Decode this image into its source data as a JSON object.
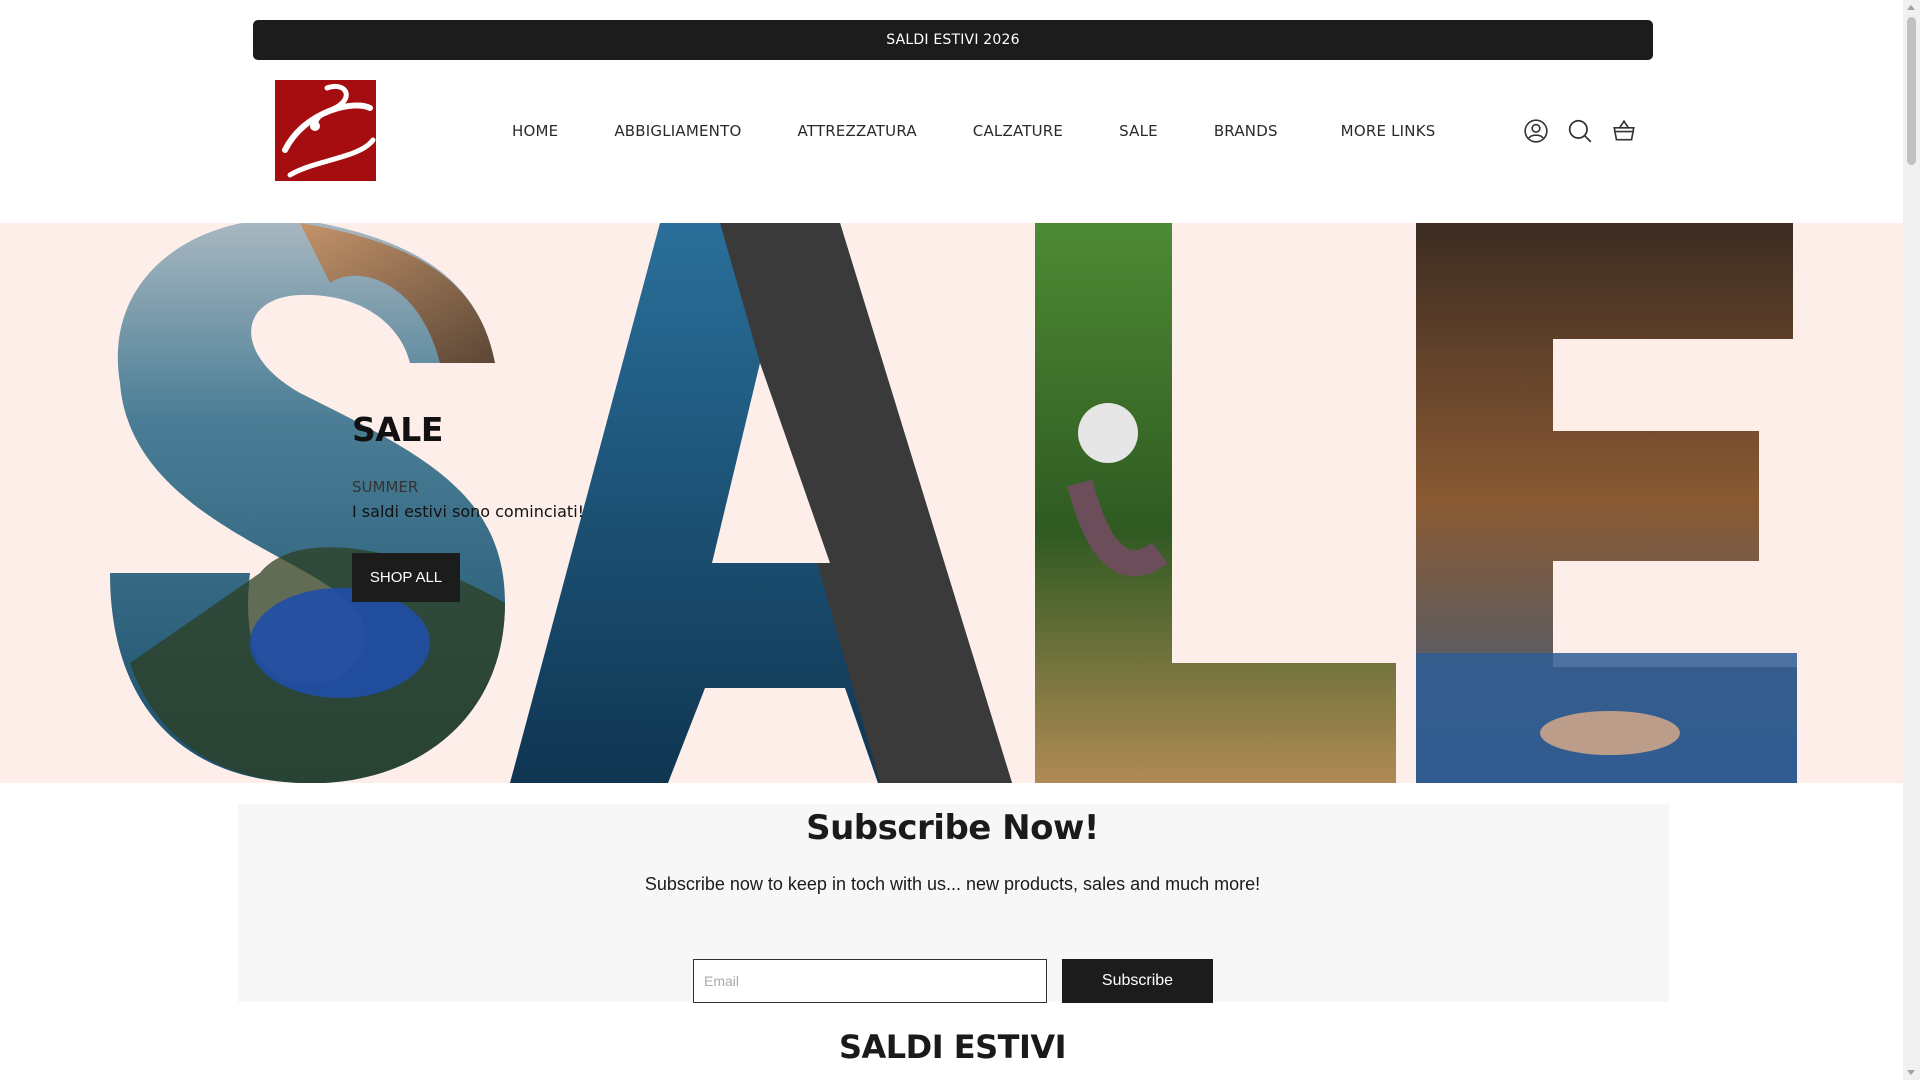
{
  "announcement": {
    "text": "SALDI ESTIVI 2026"
  },
  "header": {
    "logo_icon": "brand-logo",
    "nav": [
      {
        "label": "HOME"
      },
      {
        "label": "ABBIGLIAMENTO"
      },
      {
        "label": "ATTREZZATURA"
      },
      {
        "label": "CALZATURE"
      },
      {
        "label": "SALE"
      },
      {
        "label": "BRANDS"
      },
      {
        "label": "MORE LINKS"
      }
    ],
    "icons": [
      "account-icon",
      "search-icon",
      "cart-icon"
    ]
  },
  "hero": {
    "big_letters": "SALE",
    "title": "SALE",
    "subtitle": "SUMMER",
    "description": "I saldi estivi sono cominciati!",
    "button_label": "SHOP ALL"
  },
  "subscribe": {
    "title": "Subscribe Now!",
    "text": "Subscribe now to keep in toch with us... new products, sales and much more!",
    "email_placeholder": "Email",
    "button_label": "Subscribe"
  },
  "section": {
    "title": "SALDI ESTIVI"
  },
  "colors": {
    "brand_red": "#a60d10",
    "dark": "#1c1c1c",
    "hero_bg": "#fdeeea",
    "subscribe_bg": "#f7f7f7"
  }
}
